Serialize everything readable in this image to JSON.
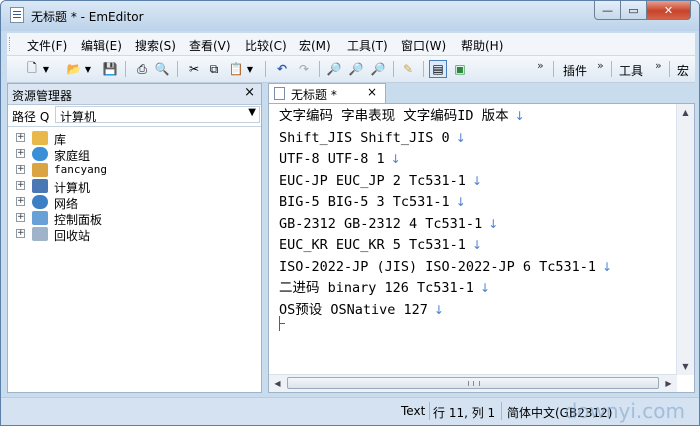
{
  "window": {
    "title": "无标题 * - EmEditor",
    "minimize": "—",
    "maximize": "▭",
    "close": "✕"
  },
  "menu": {
    "items": [
      "文件(F)",
      "编辑(E)",
      "搜索(S)",
      "查看(V)",
      "比较(C)",
      "宏(M)",
      "工具(T)",
      "窗口(W)",
      "帮助(H)"
    ]
  },
  "toolbar": {
    "plugin_label": "插件",
    "tools_label": "工具",
    "macro_label": "宏",
    "overflow": "»"
  },
  "explorer": {
    "title": "资源管理器",
    "close": "×",
    "path_label": "路径 Q",
    "path_value": "计算机",
    "tree": [
      {
        "label": "库",
        "icon": "library-icon",
        "color": "#e8b84a"
      },
      {
        "label": "家庭组",
        "icon": "homegroup-icon",
        "color": "#3a8fd6"
      },
      {
        "label": "fancyang",
        "icon": "user-folder-icon",
        "color": "#d9a441"
      },
      {
        "label": "计算机",
        "icon": "computer-icon",
        "color": "#4a78b5"
      },
      {
        "label": "网络",
        "icon": "network-icon",
        "color": "#3d7fc4"
      },
      {
        "label": "控制面板",
        "icon": "control-panel-icon",
        "color": "#6aa0d8"
      },
      {
        "label": "回收站",
        "icon": "recycle-bin-icon",
        "color": "#9fb4c8"
      }
    ]
  },
  "editor": {
    "tab_label": "无标题 *",
    "tab_close": "×",
    "lines": [
      "文字编码 字串表现 文字编码ID 版本",
      "Shift_JIS Shift_JIS 0",
      "UTF-8 UTF-8 1",
      "EUC-JP EUC_JP 2 Tc531-1",
      "BIG-5 BIG-5 3 Tc531-1",
      "GB-2312 GB-2312 4 Tc531-1",
      "EUC_KR EUC_KR 5 Tc531-1",
      "ISO-2022-JP (JIS) ISO-2022-JP 6 Tc531-1",
      "二进码 binary 126 Tc531-1",
      "OS预设 OSNative 127"
    ],
    "eol_marker": "↓"
  },
  "status": {
    "mode": "Text",
    "position": "行 11, 列 1",
    "encoding": "简体中文(GB2312)",
    "watermark": "downyi.com"
  }
}
